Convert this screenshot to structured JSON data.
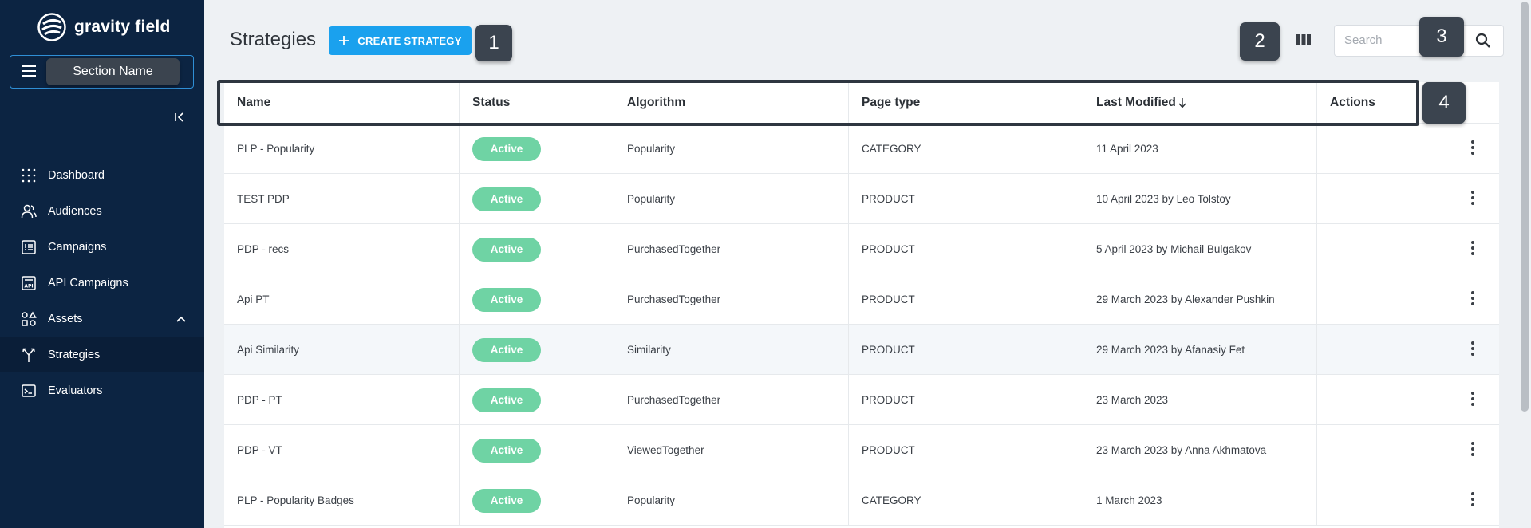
{
  "brand": {
    "name": "gravity field"
  },
  "section": {
    "label": "Section Name"
  },
  "nav": [
    {
      "label": "Dashboard",
      "icon": "dots-grid-icon"
    },
    {
      "label": "Audiences",
      "icon": "users-icon"
    },
    {
      "label": "Campaigns",
      "icon": "list-icon"
    },
    {
      "label": "API Campaigns",
      "icon": "api-icon"
    },
    {
      "label": "Assets",
      "icon": "shapes-icon",
      "expanded": true
    },
    {
      "label": "Strategies",
      "icon": "fork-icon",
      "active": true
    },
    {
      "label": "Evaluators",
      "icon": "terminal-icon"
    }
  ],
  "header": {
    "title": "Strategies",
    "create_label": "CREATE STRATEGY",
    "search_placeholder": "Search"
  },
  "annotations": [
    "1",
    "2",
    "3",
    "4"
  ],
  "table": {
    "columns": [
      "Name",
      "Status",
      "Algorithm",
      "Page type",
      "Last Modified",
      "Actions"
    ],
    "rows": [
      {
        "name": "PLP - Popularity",
        "status": "Active",
        "algorithm": "Popularity",
        "page_type": "CATEGORY",
        "modified": "11 April 2023"
      },
      {
        "name": "TEST PDP",
        "status": "Active",
        "algorithm": "Popularity",
        "page_type": "PRODUCT",
        "modified": "10 April 2023 by Leo Tolstoy"
      },
      {
        "name": "PDP - recs",
        "status": "Active",
        "algorithm": "PurchasedTogether",
        "page_type": "PRODUCT",
        "modified": "5 April 2023 by Michail Bulgakov"
      },
      {
        "name": "Api PT",
        "status": "Active",
        "algorithm": "PurchasedTogether",
        "page_type": "PRODUCT",
        "modified": "29 March 2023 by Alexander Pushkin"
      },
      {
        "name": "Api Similarity",
        "status": "Active",
        "algorithm": "Similarity",
        "page_type": "PRODUCT",
        "modified": "29 March 2023 by Afanasiy Fet"
      },
      {
        "name": "PDP - PT",
        "status": "Active",
        "algorithm": "PurchasedTogether",
        "page_type": "PRODUCT",
        "modified": "23 March 2023"
      },
      {
        "name": "PDP - VT",
        "status": "Active",
        "algorithm": "ViewedTogether",
        "page_type": "PRODUCT",
        "modified": "23 March 2023 by Anna Akhmatova"
      },
      {
        "name": "PLP - Popularity Badges",
        "status": "Active",
        "algorithm": "Popularity",
        "page_type": "CATEGORY",
        "modified": "1 March 2023"
      }
    ]
  },
  "colors": {
    "sidebar": "#0c2442",
    "accent": "#1aa1ee",
    "status_active": "#6fd3a4",
    "annotation": "#3b444f"
  }
}
